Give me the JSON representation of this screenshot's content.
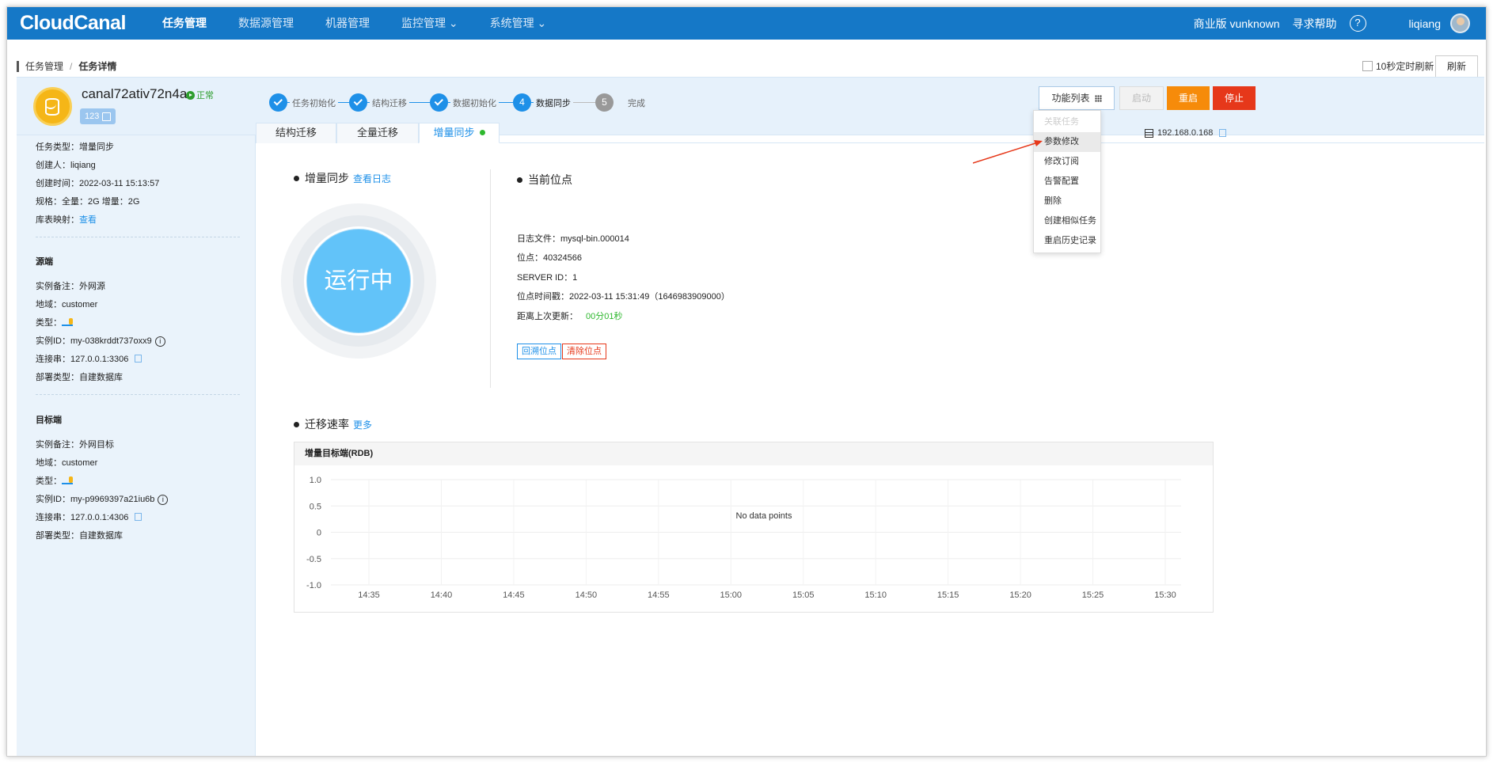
{
  "nav": {
    "logo": "CloudCanal",
    "items": [
      {
        "label": "任务管理",
        "active": true
      },
      {
        "label": "数据源管理",
        "active": false
      },
      {
        "label": "机器管理",
        "active": false
      },
      {
        "label": "监控管理 ⌄",
        "active": false
      },
      {
        "label": "系统管理 ⌄",
        "active": false
      }
    ],
    "edition": "商业版 vunknown",
    "help": "寻求帮助",
    "help_icon": "?",
    "user": "liqiang"
  },
  "breadcrumb": {
    "root": "任务管理",
    "sep": "/",
    "current": "任务详情"
  },
  "auto_refresh": "10秒定时刷新",
  "refresh_btn": "刷新",
  "task": {
    "name": "canal72ativ72n4a",
    "status": "正常",
    "tag": "123"
  },
  "steps": [
    {
      "label": "任务初始化",
      "state": "done",
      "num": ""
    },
    {
      "label": "结构迁移",
      "state": "done",
      "num": ""
    },
    {
      "label": "数据初始化",
      "state": "done",
      "num": ""
    },
    {
      "label": "数据同步",
      "state": "current",
      "num": "4"
    },
    {
      "label": "完成",
      "state": "todo",
      "num": "5"
    }
  ],
  "buttons": {
    "func": "功能列表",
    "start": "启动",
    "restart": "重启",
    "stop": "停止"
  },
  "dropdown": [
    "关联任务",
    "参数修改",
    "修改订阅",
    "告警配置",
    "删除",
    "创建相似任务",
    "重启历史记录"
  ],
  "sidebar": {
    "task_type": "任务类型：增量同步",
    "creator": "创建人：liqiang",
    "created": "创建时间：2022-03-11 15:13:57",
    "spec": "规格：全量：2G 增量：2G",
    "mapping_label": "库表映射：",
    "mapping_link": "查看",
    "source_title": "源端",
    "src_note": "实例备注：外网源",
    "src_region": "地域：customer",
    "src_type": "类型：",
    "src_id": "实例ID：my-038krddt737oxx9",
    "src_conn": "连接串：127.0.0.1:3306",
    "src_deploy": "部署类型：自建数据库",
    "target_title": "目标端",
    "tgt_note": "实例备注：外网目标",
    "tgt_region": "地域：customer",
    "tgt_type": "类型：",
    "tgt_id": "实例ID：my-p9969397a21iu6b",
    "tgt_conn": "连接串：127.0.0.1:4306",
    "tgt_deploy": "部署类型：自建数据库",
    "info_icon": "i"
  },
  "tabs": [
    "结构迁移",
    "全量迁移",
    "增量同步"
  ],
  "ip": "192.168.0.168",
  "sync": {
    "title": "增量同步",
    "log_link": "查看日志",
    "running": "运行中"
  },
  "position": {
    "title": "当前位点",
    "log_file": "日志文件：mysql-bin.000014",
    "pos": "位点：40324566",
    "server_id": "SERVER ID：1",
    "pos_time": "位点时间戳：2022-03-11 15:31:49（1646983909000）",
    "since_label": "距离上次更新：",
    "since_value": "00分01秒",
    "btn_back": "回溯位点",
    "btn_clear": "清除位点"
  },
  "rate": {
    "title": "迁移速率",
    "more": "更多"
  },
  "chart_data": {
    "type": "line",
    "title": "增量目标端(RDB)",
    "x": [
      "14:35",
      "14:40",
      "14:45",
      "14:50",
      "14:55",
      "15:00",
      "15:05",
      "15:10",
      "15:15",
      "15:20",
      "15:25",
      "15:30"
    ],
    "y_ticks": [
      "1.0",
      "0.5",
      "0",
      "-0.5",
      "-1.0"
    ],
    "ylim": [
      -1,
      1
    ],
    "series": [],
    "empty_message": "No data points",
    "grid": true
  }
}
